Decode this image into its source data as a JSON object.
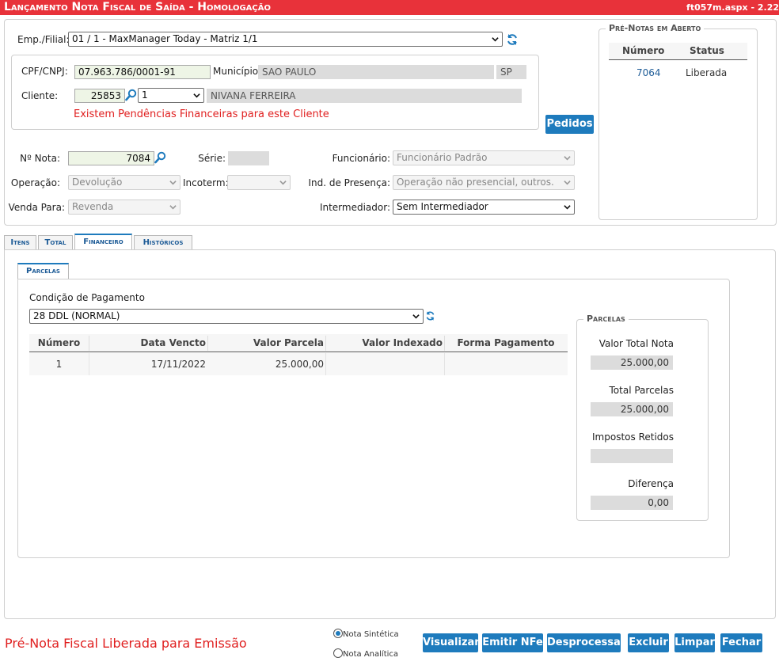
{
  "window": {
    "title": "Lançamento Nota Fiscal de Saída  - Homologação",
    "page_ref": "ft057m.aspx - 2.22"
  },
  "header": {
    "emp_filial_label": "Emp./Filial:",
    "emp_filial_value": "01 / 1 - MaxManager Today - Matriz 1/1",
    "cpf_label": "CPF/CNPJ:",
    "cpf_value": "07.963.786/0001-91",
    "municipio_label": "Município:",
    "municipio_value": "SAO PAULO",
    "uf_value": "SP",
    "cliente_label": "Cliente:",
    "cliente_code": "25853",
    "cliente_select": "1",
    "cliente_name": "NIVANA FERREIRA",
    "pendencias": "Existem Pendências Financeiras para este Cliente",
    "pedidos_button": "Pedidos"
  },
  "nota": {
    "numero_label": "Nº Nota:",
    "numero_value": "7084",
    "serie_label": "Série:",
    "serie_value": "",
    "funcionario_label": "Funcionário:",
    "funcionario_value": "Funcionário Padrão",
    "operacao_label": "Operação:",
    "operacao_value": "Devolução",
    "incoterm_label": "Incoterm:",
    "incoterm_value": "",
    "presenca_label": "Ind. de Presença:",
    "presenca_value": "Operação não presencial, outros.",
    "venda_label": "Venda Para:",
    "venda_value": "Revenda",
    "intermediador_label": "Intermediador:",
    "intermediador_value": "Sem Intermediador"
  },
  "pre_notas": {
    "legend": "Pré-Notas em Aberto",
    "col_numero": "Número",
    "col_status": "Status",
    "rows": [
      {
        "numero": "7064",
        "status": "Liberada"
      }
    ]
  },
  "tabs": [
    "Itens",
    "Total",
    "Financeiro",
    "Históricos"
  ],
  "subtab": "Parcelas",
  "financeiro": {
    "condicao_label": "Condição de Pagamento",
    "condicao_value": "28 DDL (NORMAL)",
    "columns": [
      "Número",
      "Data Vencto",
      "Valor Parcela",
      "Valor Indexado",
      "Forma Pagamento"
    ],
    "rows": [
      {
        "numero": "1",
        "data": "17/11/2022",
        "valor": "25.000,00",
        "indexado": "",
        "forma": ""
      }
    ]
  },
  "parcelas_box": {
    "legend": "Parcelas",
    "valor_total_label": "Valor Total Nota",
    "valor_total_value": "25.000,00",
    "total_parcelas_label": "Total Parcelas",
    "total_parcelas_value": "25.000,00",
    "impostos_label": "Impostos Retidos",
    "impostos_value": "",
    "diferenca_label": "Diferença",
    "diferenca_value": "0,00"
  },
  "footer": {
    "status": "Pré-Nota Fiscal Liberada para Emissão",
    "radio_sintetica": "Nota Sintética",
    "radio_analitica": "Nota Analítica",
    "buttons": [
      "Visualizar",
      "Emitir NFe",
      "Desprocessar",
      "Excluir",
      "Limpar",
      "Fechar"
    ]
  },
  "colors": {
    "title_bar": "#e8323a",
    "accent": "#1e7bbd",
    "warning_text": "#e02020"
  }
}
